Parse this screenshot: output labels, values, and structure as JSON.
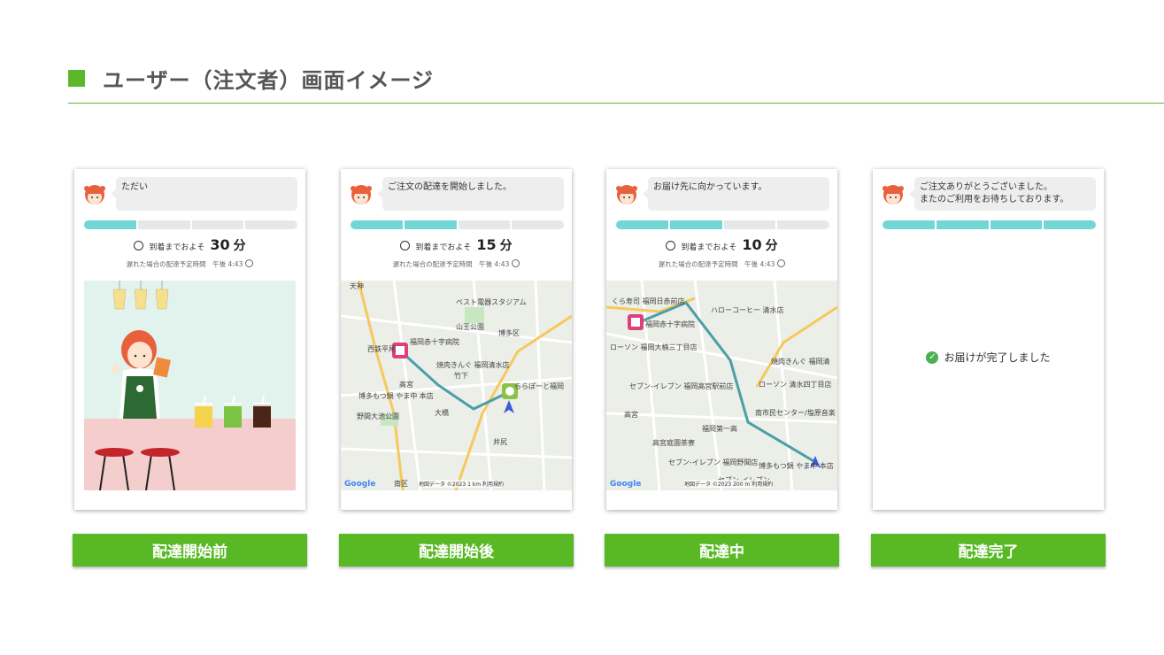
{
  "header": {
    "title": "ユーザー（注文者）画面イメージ"
  },
  "colors": {
    "accent": "#5cb82a",
    "progress": "#73d6d6",
    "button": "#58b924"
  },
  "screens": [
    {
      "message": "ただい",
      "progress_filled": 1,
      "eta_label": "到着までおよそ",
      "eta_minutes": "30",
      "eta_unit": "分",
      "late_note": "遅れた場合の配達予定時間　午後 4:43",
      "button_label": "配達開始前"
    },
    {
      "message": "ご注文の配達を開始しました。",
      "progress_filled": 2,
      "eta_label": "到着までおよそ",
      "eta_minutes": "15",
      "eta_unit": "分",
      "late_note": "遅れた場合の配達予定時間　午後 4:43",
      "map_labels": [
        "天神",
        "ベスト電器スタジアム",
        "山王公園",
        "博多区",
        "福岡赤十字病院",
        "焼肉きんぐ 福岡清水店",
        "竹下",
        "ららぽーと福岡",
        "博多もつ鍋 やま中 本店",
        "大橋",
        "野間大池公園",
        "井尻",
        "南区",
        "西鉄平尾",
        "高宮"
      ],
      "map_credit": "Google",
      "map_footer": "地図データ ©2023   1 km   利用規約",
      "button_label": "配達開始後"
    },
    {
      "message": "お届け先に向かっています。",
      "progress_filled": 2,
      "eta_label": "到着までおよそ",
      "eta_minutes": "10",
      "eta_unit": "分",
      "late_note": "遅れた場合の配達予定時間　午後 4:43",
      "map_labels": [
        "くら寿司 福岡日赤前店",
        "ハローコーヒー 清水店",
        "福岡赤十字病院",
        "ローソン 福岡大楠三丁目店",
        "焼肉きんぐ 福岡清",
        "セブン-イレブン 福岡高宮駅前店",
        "ローソン 清水四丁目店",
        "高宮",
        "南市民センター/塩原音楽・演劇練習場",
        "福岡第一高",
        "高宮庭園茶寮",
        "セブン-イレブン 福岡野間店",
        "博多もつ鍋 やま中 本店",
        "セブン-イレブン"
      ],
      "map_credit": "Google",
      "map_footer": "地図データ ©2023   200 m   利用規約",
      "button_label": "配達中"
    },
    {
      "message": "ご注文ありがとうございました。\nまたのご利用をお待ちしております。",
      "progress_filled": 4,
      "done_text": "お届けが完了しました",
      "button_label": "配達完了"
    }
  ]
}
